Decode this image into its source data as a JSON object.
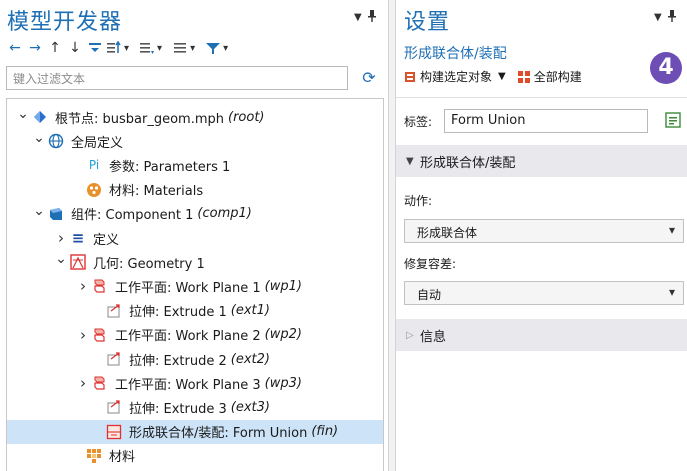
{
  "model_builder": {
    "title": "模型开发器",
    "filter_placeholder": "键入过滤文本",
    "tree": [
      {
        "label": "根节点: busbar_geom.mph",
        "tag": "(root)",
        "twisty": "v",
        "icon": "root-icon",
        "icon_color": "#2a6fd0"
      },
      {
        "label": "全局定义",
        "tag": "",
        "twisty": "v",
        "icon": "globe-icon",
        "icon_color": "#1f6fb5"
      },
      {
        "label": "参数: Parameters 1",
        "tag": "",
        "twisty": "",
        "icon": "parameters-icon",
        "icon_glyph": "Pi",
        "icon_color": "#1f9fd5"
      },
      {
        "label": "材料: Materials",
        "tag": "",
        "twisty": "",
        "icon": "materials-icon",
        "icon_color": "#e8912b"
      },
      {
        "label": "组件: Component 1",
        "tag": "(comp1)",
        "twisty": "v",
        "icon": "component-icon",
        "icon_color": "#1f6fb5"
      },
      {
        "label": "定义",
        "tag": "",
        "twisty": ">",
        "icon": "definitions-icon",
        "icon_glyph": "≡",
        "icon_color": "#1f4fa5"
      },
      {
        "label": "几何: Geometry 1",
        "tag": "",
        "twisty": "v",
        "icon": "geometry-icon",
        "icon_color": "#d33"
      },
      {
        "label": "工作平面: Work Plane 1",
        "tag": "(wp1)",
        "twisty": ">",
        "icon": "work-plane-icon",
        "icon_color": "#d33"
      },
      {
        "label": "拉伸: Extrude 1",
        "tag": "(ext1)",
        "twisty": "",
        "icon": "extrude-icon",
        "icon_color": "#d33"
      },
      {
        "label": "工作平面: Work Plane 2",
        "tag": "(wp2)",
        "twisty": ">",
        "icon": "work-plane-icon",
        "icon_color": "#d33"
      },
      {
        "label": "拉伸: Extrude 2",
        "tag": "(ext2)",
        "twisty": "",
        "icon": "extrude-icon",
        "icon_color": "#d33"
      },
      {
        "label": "工作平面: Work Plane 3",
        "tag": "(wp3)",
        "twisty": ">",
        "icon": "work-plane-icon",
        "icon_color": "#d33"
      },
      {
        "label": "拉伸: Extrude 3",
        "tag": "(ext3)",
        "twisty": "",
        "icon": "extrude-icon",
        "icon_color": "#d33"
      },
      {
        "label": "形成联合体/装配: Form Union",
        "tag": "(fin)",
        "twisty": "",
        "icon": "form-union-icon",
        "icon_color": "#d33",
        "selected": true
      },
      {
        "label": "材料",
        "tag": "",
        "twisty": "",
        "icon": "materials-grid-icon",
        "icon_color": "#e8912b"
      }
    ]
  },
  "settings": {
    "title": "设置",
    "subtitle": "形成联合体/装配",
    "build_selected": "构建选定对象",
    "build_all": "全部构建",
    "badge": "4",
    "label_key": "标签:",
    "label_value": "Form Union",
    "section_main": "形成联合体/装配",
    "action_label": "动作:",
    "action_value": "形成联合体",
    "repair_label": "修复容差:",
    "repair_value": "自动",
    "section_info": "信息"
  },
  "colors": {
    "accent": "#1f6fb5",
    "selection": "#cde3f7",
    "badge": "#6c4eb5",
    "section_bg": "#e8e8ed"
  }
}
